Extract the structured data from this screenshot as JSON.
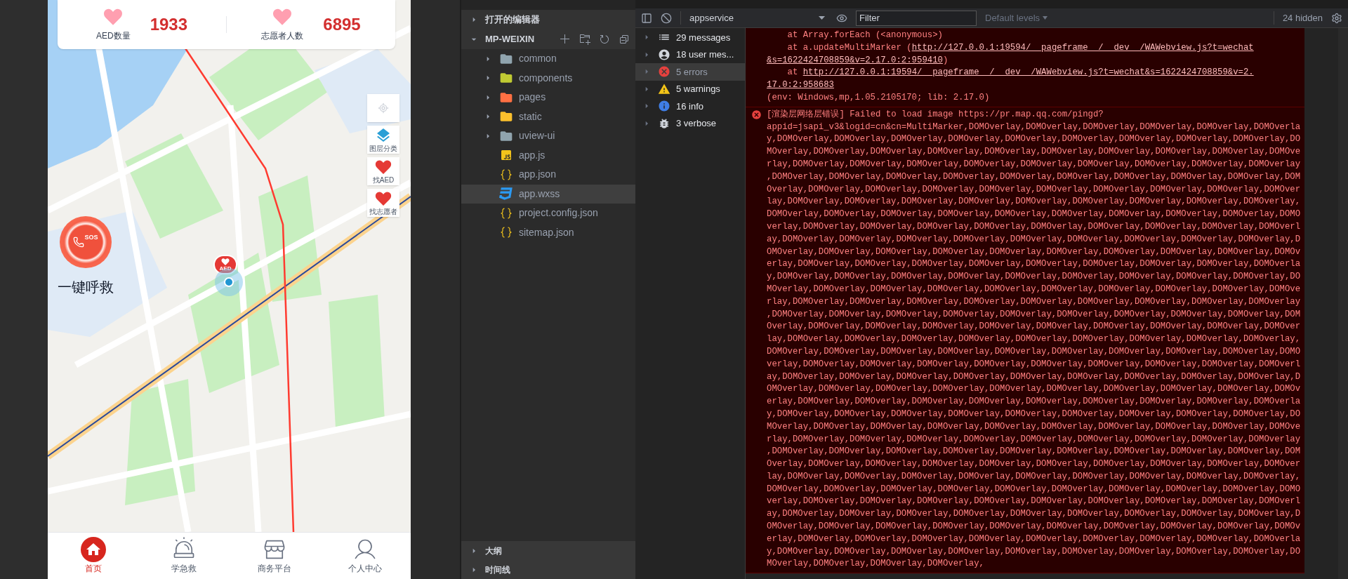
{
  "phone": {
    "stats": [
      {
        "label": "AED数量",
        "value": "1933"
      },
      {
        "label": "志愿者人数",
        "value": "6895"
      }
    ],
    "map_tools": [
      {
        "kind": "locate"
      },
      {
        "kind": "layers",
        "label": "图层分类"
      },
      {
        "kind": "aed",
        "label": "找AED"
      },
      {
        "kind": "volunteer",
        "label": "找志愿者"
      }
    ],
    "sos": {
      "badge": "SOS",
      "label": "一键呼救"
    },
    "aed_marker": {
      "label": "AED"
    },
    "tabs": [
      {
        "kind": "home",
        "label": "首页",
        "selected": true
      },
      {
        "kind": "siren",
        "label": "学急救",
        "selected": false
      },
      {
        "kind": "store",
        "label": "商务平台",
        "selected": false
      },
      {
        "kind": "user",
        "label": "个人中心",
        "selected": false
      }
    ]
  },
  "explorer": {
    "sections": [
      {
        "label": "打开的编辑器",
        "expanded": false
      },
      {
        "label": "MP-WEIXIN",
        "expanded": true
      }
    ],
    "items": [
      {
        "kind": "folder",
        "name": "common",
        "color": "#90a4ae",
        "selected": false
      },
      {
        "kind": "folder",
        "name": "components",
        "color": "#c0ca33",
        "selected": false
      },
      {
        "kind": "folder",
        "name": "pages",
        "color": "#ff7043",
        "selected": false
      },
      {
        "kind": "folder",
        "name": "static",
        "color": "#fbc02d",
        "selected": false
      },
      {
        "kind": "folder",
        "name": "uview-ui",
        "color": "#90a4ae",
        "selected": false
      },
      {
        "kind": "js",
        "name": "app.js",
        "selected": false
      },
      {
        "kind": "json",
        "name": "app.json",
        "selected": false
      },
      {
        "kind": "css",
        "name": "app.wxss",
        "selected": true
      },
      {
        "kind": "json",
        "name": "project.config.json",
        "selected": false
      },
      {
        "kind": "json",
        "name": "sitemap.json",
        "selected": false
      }
    ],
    "bottom_sections": [
      {
        "label": "大纲",
        "expanded": false
      },
      {
        "label": "时间线",
        "expanded": false
      }
    ]
  },
  "console": {
    "context": "appservice",
    "filter": {
      "placeholder": "Filter"
    },
    "levels": "Default levels",
    "hidden": "24 hidden",
    "sidebar": [
      {
        "kind": "list",
        "label": "29 messages",
        "selected": false
      },
      {
        "kind": "user",
        "label": "18 user mes...",
        "selected": false
      },
      {
        "kind": "error",
        "label": "5 errors",
        "selected": true
      },
      {
        "kind": "warning",
        "label": "5 warnings",
        "selected": false
      },
      {
        "kind": "info",
        "label": "16 info",
        "selected": false
      },
      {
        "kind": "verbose",
        "label": "3 verbose",
        "selected": false
      }
    ],
    "messages": [
      {
        "kind": "continuation",
        "lines": [
          {
            "text": "    at Array.forEach (<anonymous>)"
          },
          {
            "text": "    at a.updateMultiMarker (",
            "link": [
              "http://127.0.0.1:19594/__pageframe__/__dev__/WAWebview.js?t=wechat",
              "&s=1622424708859&v=2.17.0:2:959410"
            ],
            "after": ")"
          },
          {
            "text": "    at ",
            "link": [
              "http://127.0.0.1:19594/__pageframe__/__dev__/WAWebview.js?t=wechat&s=1622424708859&v=2.",
              "17.0:2:958683"
            ]
          },
          {
            "text": "(env: Windows,mp,1.05.2105170; lib: 2.17.0)"
          }
        ]
      },
      {
        "kind": "error",
        "lines": [
          {
            "text": "[渲染层网络层错误] Failed to load image https://pr.map.qq.com/pingd?appid=jsapi_v3&logid=cn&cn=MultiMarker,DOMOverlay,DOMOverlay,DOMOverlay,DOMOverlay,DOMOverlay,DOMOverlay,DOMOverlay,DOMOverlay,DOMOverlay,DOMOverlay,DOMOverlay,DOMOverlay,DOMOverlay,DOMOverlay,DOMOverlay,DOMOverlay,DOMOverlay,DOMOverlay,DOMOverlay,DOMOverlay,DOMOverlay,DOMOverlay,DOMOverlay,DOMOverlay,DOMOverlay,DOMOverlay,DOMOverlay,DOMOverlay,DOMOverlay,DOMOverlay,DOMOverlay,DOMOverlay,DOMOverlay,DOMOverlay,DOMOverlay,DOMOverlay,DOMOverlay,DOMOverlay,DOMOverlay,DOMOverlay,DOMOverlay,DOMOverlay,DOMOverlay,DOMOverlay,DOMOverlay,DOMOverlay,DOMOverlay,DOMOverlay,DOMOverlay,DOMOverlay,DOMOverlay,DOMOverlay,DOMOverlay,DOMOverlay,DOMOverlay,DOMOverlay,DOMOverlay,DOMOverlay,DOMOverlay,DOMOverlay,DOMOverlay,DOMOverlay,DOMOverlay,DOMOverlay,DOMOverlay,DOMOverlay,DOMOverlay,DOMOverlay,DOMOverlay,DOMOverlay,DOMOverlay,DOMOverlay,DOMOverlay,DOMOverlay,DOMOverlay,DOMOverlay,DOMOverlay,DOMOverlay,DOMOverlay,DOMOverlay,DOMOverlay,DOMOverlay,DOMOverlay,DOMOverlay,DOMOverlay,DOMOverlay,DOMOverlay,DOMOverlay,DOMOverlay,DOMOverlay,DOMOverlay,DOMOverlay,DOMOverlay,DOMOverlay,DOMOverlay,DOMOverlay,DOMOverlay,DOMOverlay,DOMOverlay,DOMOverlay,DOMOverlay,DOMOverlay,DOMOverlay,DOMOverlay,DOMOverlay,DOMOverlay,DOMOverlay,DOMOverlay,DOMOverlay,DOMOverlay,DOMOverlay,DOMOverlay,DOMOverlay,DOMOverlay,DOMOverlay,DOMOverlay,DOMOverlay,DOMOverlay,DOMOverlay,DOMOverlay,DOMOverlay,DOMOverlay,DOMOverlay,DOMOverlay,DOMOverlay,DOMOverlay,DOMOverlay,DOMOverlay,DOMOverlay,DOMOverlay,DOMOverlay,DOMOverlay,DOMOverlay,DOMOverlay,DOMOverlay,DOMOverlay,DOMOverlay,DOMOverlay,DOMOverlay,DOMOverlay,DOMOverlay,DOMOverlay,DOMOverlay,DOMOverlay,DOMOverlay,DOMOverlay,DOMOverlay,DOMOverlay,DOMOverlay,DOMOverlay,DOMOverlay,DOMOverlay,DOMOverlay,DOMOverlay,DOMOverlay,DOMOverlay,DOMOverlay,DOMOverlay,DOMOverlay,DOMOverlay,DOMOverlay,DOMOverlay,DOMOverlay,DOMOverlay,DOMOverlay,DOMOverlay,DOMOverlay,DOMOverlay,DOMOverlay,DOMOverlay,DOMOverlay,DOMOverlay,DOMOverlay,DOMOverlay,DOMOverlay,DOMOverlay,DOMOverlay,DOMOverlay,DOMOverlay,DOMOverlay,DOMOverlay,DOMOverlay,DOMOverlay,DOMOverlay,DOMOverlay,DOMOverlay,DOMOverlay,DOMOverlay,DOMOverlay,DOMOverlay,DOMOverlay,DOMOverlay,DOMOverlay,DOMOverlay,DOMOverlay,DOMOverlay,DOMOverlay,DOMOverlay,DOMOverlay,DOMOverlay,DOMOverlay,DOMOverlay,DOMOverlay,DOMOverlay,DOMOverlay,DOMOverlay,DOMOverlay,DOMOverlay,DOMOverlay,DOMOverlay,DOMOverlay,DOMOverlay,DOMOverlay,DOMOverlay,DOMOverlay,DOMOverlay,DOMOverlay,DOMOverlay,DOMOverlay,DOMOverlay,DOMOverlay,DOMOverlay,DOMOverlay,DOMOverlay,DOMOverlay,DOMOverlay,DOMOverlay,DOMOverlay,DOMOverlay,DOMOverlay,DOMOverlay,DOMOverlay,DOMOverlay,DOMOverlay,DOMOverlay,DOMOverlay,DOMOverlay,DOMOverlay,DOMOverlay,DOMOverlay,DOMOverlay,DOMOverlay,DOMOverlay,DOMOverlay,DOMOverlay,DOMOverlay,DOMOverlay,DOMOverlay,DOMOverlay,DOMOverlay,DOMOverlay,DOMOverlay,DOMOverlay,DOMOverlay,DOMOverlay,DOMOverlay,DOMOverlay,DOMOverlay,DOMOverlay,DOMOverlay,DOMOverlay,DOMOverlay,DOMOverlay,DOMOverlay,DOMOverlay,DOMOverlay,DOMOverlay,DOMOverlay,DOMOverlay,DOMOverlay,DOMOverlay,DOMOverlay,DOMOverlay,DOMOverlay,DOMOverlay,DOMOverlay,DOMOverlay,DOMOverlay,DOMOverlay,DOMOverlay,DOMOverlay,DOMOverlay,DOMOverlay,DOMOverlay,DOMOverlay,DOMOverlay,DOMOverlay,DOMOverlay,DOMOverlay,DOMOverlay,DOMOverlay,DOMOverlay,DOMOverlay,DOMOverlay,DOMOverlay,DOMOverlay,DOMOverlay,DOMOverlay,DOMOverlay,DOMOverlay,DOMOverlay,DOMOverlay,DOMOverlay,DOMOverlay,DOMOverlay,DOMOverlay,DOMOverlay,DOMOverlay,DOMOverlay,DOMOverlay,DOMOverlay,DOMOverlay,DOMOverlay,DOMOverlay,DOMOverlay,DOMOverlay,DOMOverlay,DOMOverlay,DOMOverlay,DOMOverlay,DOMOverlay,DOMOverlay,DOMOverlay,DOMOverlay,DOMOverlay,DOMOverlay,DOMOverlay,DOMOverlay,"
          }
        ]
      }
    ]
  }
}
